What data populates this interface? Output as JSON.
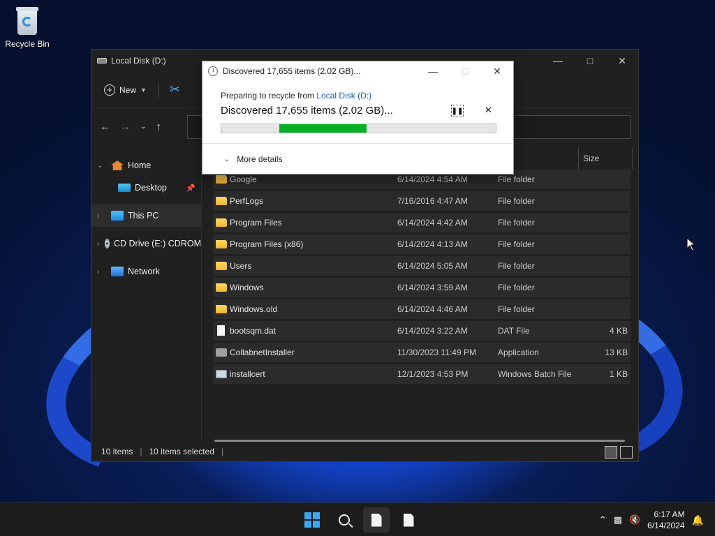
{
  "desktop": {
    "recycle_bin_label": "Recycle Bin"
  },
  "explorer": {
    "title": "Local Disk (D:)",
    "new_label": "New",
    "sidebar": [
      {
        "label": "Home",
        "icon": "home-icon",
        "expandable": true
      },
      {
        "label": "Desktop",
        "icon": "desktop-icon",
        "pinned": true
      },
      {
        "label": "This PC",
        "icon": "pc-icon",
        "selected": true
      },
      {
        "label": "CD Drive (E:) CDROM",
        "icon": "cd-drive-icon"
      },
      {
        "label": "Network",
        "icon": "network-icon"
      }
    ],
    "columns": {
      "size": "Size"
    },
    "files": [
      {
        "name": "Google",
        "date": "6/14/2024 4:54 AM",
        "type": "File folder",
        "size": "",
        "icon": "folder"
      },
      {
        "name": "PerfLogs",
        "date": "7/16/2016 4:47 AM",
        "type": "File folder",
        "size": "",
        "icon": "folder"
      },
      {
        "name": "Program Files",
        "date": "6/14/2024 4:42 AM",
        "type": "File folder",
        "size": "",
        "icon": "folder"
      },
      {
        "name": "Program Files (x86)",
        "date": "6/14/2024 4:13 AM",
        "type": "File folder",
        "size": "",
        "icon": "folder"
      },
      {
        "name": "Users",
        "date": "6/14/2024 5:05 AM",
        "type": "File folder",
        "size": "",
        "icon": "folder"
      },
      {
        "name": "Windows",
        "date": "6/14/2024 3:59 AM",
        "type": "File folder",
        "size": "",
        "icon": "folder"
      },
      {
        "name": "Windows.old",
        "date": "6/14/2024 4:46 AM",
        "type": "File folder",
        "size": "",
        "icon": "folder"
      },
      {
        "name": "bootsqm.dat",
        "date": "6/14/2024 3:22 AM",
        "type": "DAT File",
        "size": "4 KB",
        "icon": "doc"
      },
      {
        "name": "CollabnetInstaller",
        "date": "11/30/2023 11:49 PM",
        "type": "Application",
        "size": "13 KB",
        "icon": "app"
      },
      {
        "name": "installcert",
        "date": "12/1/2023 4:53 PM",
        "type": "Windows Batch File",
        "size": "1 KB",
        "icon": "bat"
      }
    ],
    "status": {
      "items": "10 items",
      "selected": "10 items selected"
    }
  },
  "dialog": {
    "title": "Discovered 17,655 items (2.02 GB)...",
    "sub_prefix": "Preparing to recycle from ",
    "sub_link": "Local Disk (D:)",
    "main": "Discovered 17,655 items (2.02 GB)...",
    "progress_start": 0.21,
    "progress_end": 0.53,
    "progress_color": "#06b025",
    "more_details": "More details"
  },
  "taskbar": {
    "time": "6:17 AM",
    "date": "6/14/2024"
  }
}
